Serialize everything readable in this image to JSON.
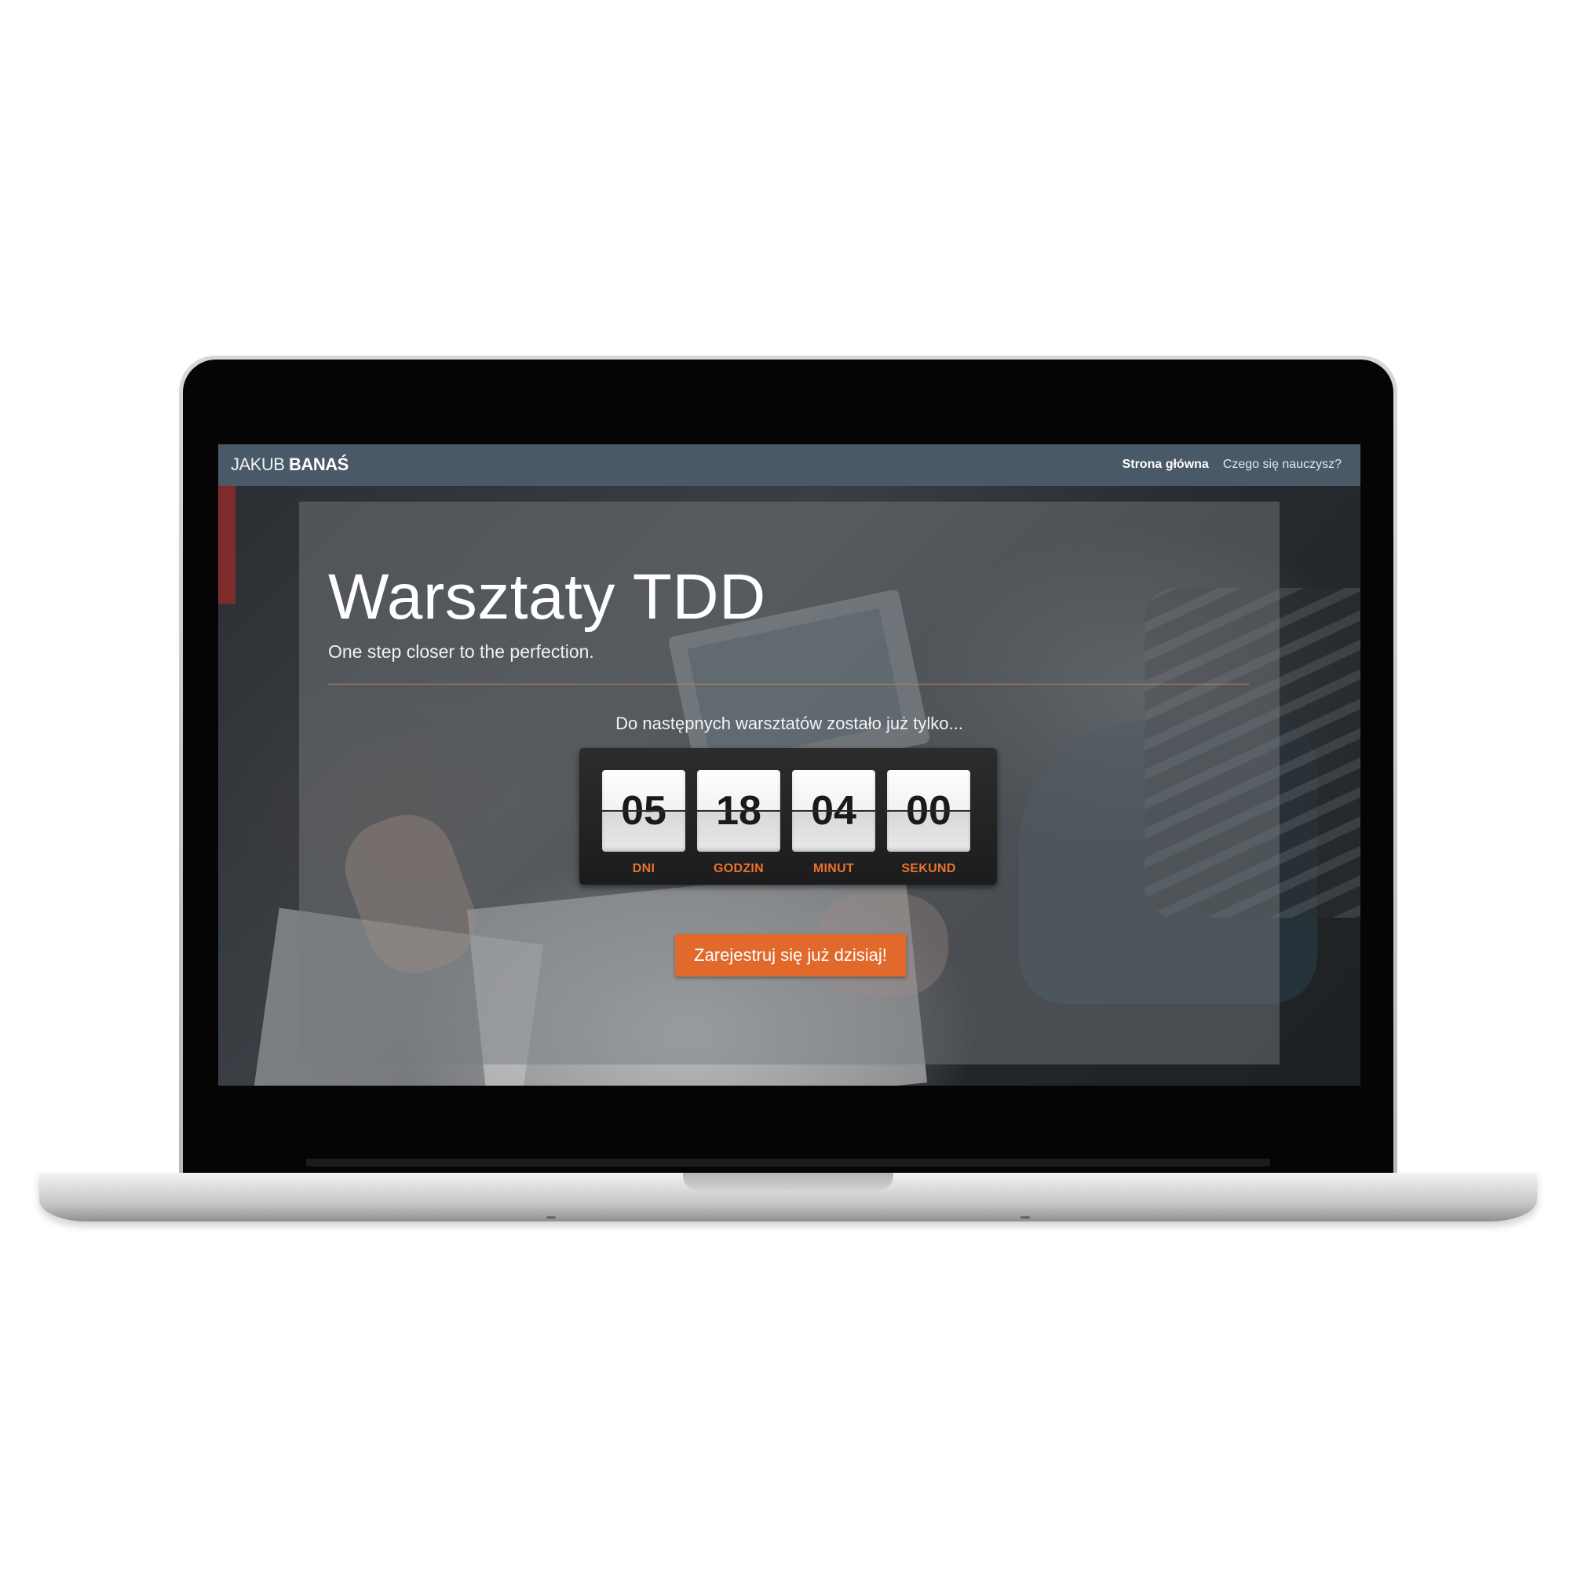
{
  "navbar": {
    "brand_light": "JAKUB",
    "brand_bold": "BANAŚ",
    "links": [
      {
        "label": "Strona główna",
        "active": true
      },
      {
        "label": "Czego się nauczysz?",
        "active": false
      }
    ]
  },
  "hero": {
    "title": "Warsztaty TDD",
    "subtitle": "One step closer to the perfection.",
    "countdown_label": "Do następnych warsztatów zostało już tylko...",
    "countdown": [
      {
        "value": "05",
        "unit": "DNI"
      },
      {
        "value": "18",
        "unit": "GODZIN"
      },
      {
        "value": "04",
        "unit": "MINUT"
      },
      {
        "value": "00",
        "unit": "SEKUND"
      }
    ],
    "cta_label": "Zarejestruj się już dzisiaj!"
  },
  "colors": {
    "navbar": "#4a5967",
    "accent": "#e2692c",
    "divider": "#b48a4e"
  }
}
